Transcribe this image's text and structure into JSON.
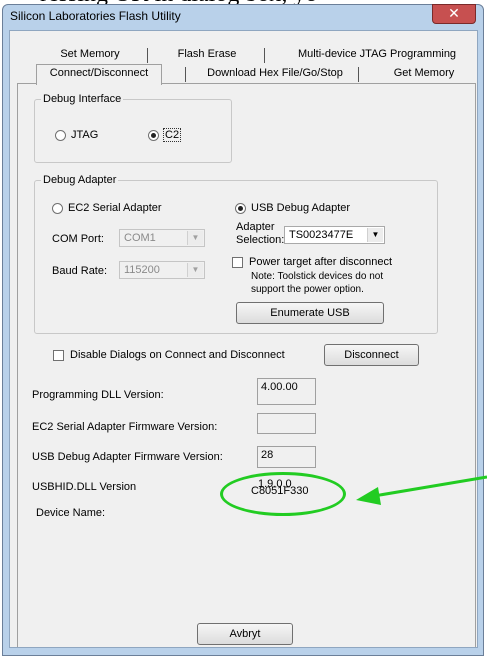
{
  "caption_fragment": "ressing OK in dialog box, yo",
  "window": {
    "title": "Silicon Laboratories Flash Utility",
    "close_glyph": "✕"
  },
  "tabs": {
    "row1": [
      "Set Memory",
      "Flash Erase",
      "Multi-device JTAG Programming"
    ],
    "row2": [
      "Connect/Disconnect",
      "Download Hex File/Go/Stop",
      "Get Memory"
    ]
  },
  "debug_interface": {
    "label": "Debug Interface",
    "jtag": "JTAG",
    "c2": "C2",
    "selected": "C2"
  },
  "debug_adapter": {
    "label": "Debug Adapter",
    "ec2_serial": "EC2 Serial Adapter",
    "usb_debug": "USB Debug Adapter",
    "selected": "USB Debug Adapter",
    "com_port_label": "COM Port:",
    "com_port_value": "COM1",
    "baud_rate_label": "Baud Rate:",
    "baud_rate_value": "115200",
    "adapter_selection_label_line1": "Adapter",
    "adapter_selection_label_line2": "Selection:",
    "adapter_selection_value": "TS0023477E",
    "power_target_label": "Power target after disconnect",
    "note_line1": "Note: Toolstick devices do not",
    "note_line2": "support the power option.",
    "enumerate_button": "Enumerate USB"
  },
  "disable_dialogs_label": "Disable Dialogs on Connect and Disconnect",
  "disconnect_button": "Disconnect",
  "info": {
    "programming_dll_label": "Programming DLL Version:",
    "programming_dll_value": "4.00.00",
    "ec2_firmware_label": "EC2 Serial Adapter Firmware Version:",
    "ec2_firmware_value": "",
    "usb_firmware_label": "USB Debug Adapter Firmware Version:",
    "usb_firmware_value": "28",
    "usbhid_label": "USBHID.DLL Version",
    "usbhid_value": "1.9.0.0",
    "device_name_label": "Device Name:",
    "device_name_value": "C8051F330"
  },
  "cancel_button": "Avbryt",
  "colors": {
    "annotation_green": "#22cc22",
    "close_red": "#c75050",
    "frame_blue": "#b9d1ea"
  }
}
